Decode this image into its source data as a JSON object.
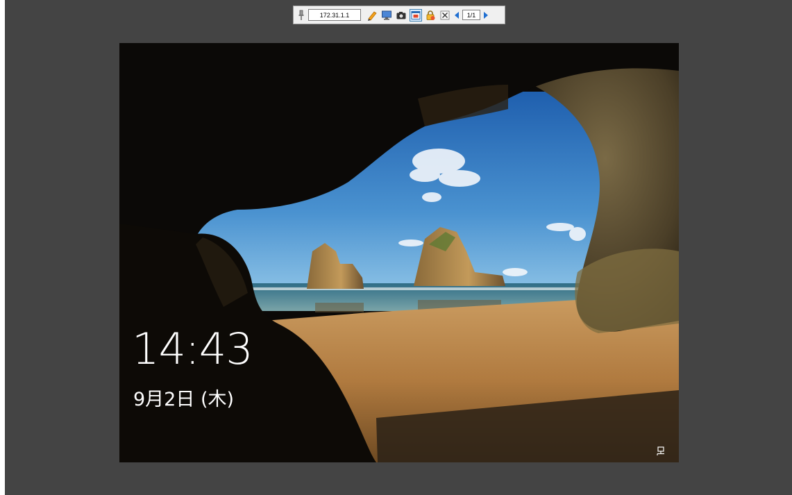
{
  "toolbar": {
    "address": "172.31.1.1",
    "page_indicator": "1/1",
    "icons": [
      "pin-icon",
      "pencil-icon",
      "monitor-icon",
      "camera-icon",
      "fit-window-icon",
      "lock-icon",
      "close-icon",
      "prev-arrow-icon",
      "next-arrow-icon"
    ]
  },
  "lockscreen": {
    "time": "14:43",
    "date": "9月2日 (木)",
    "network_icon": "network-icon"
  },
  "colors": {
    "viewer_background": "#444444",
    "toolbar_background": "#f0f0f0",
    "sky": "#3b82c4",
    "sand": "#b8864e",
    "rock": "#6b5430"
  }
}
